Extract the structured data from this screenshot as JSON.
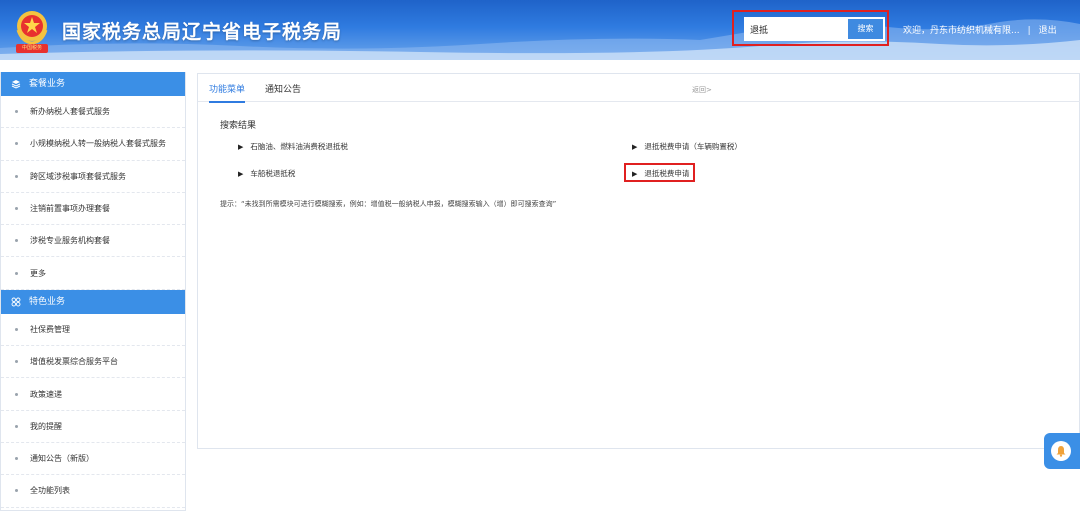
{
  "header": {
    "site_title": "国家税务总局辽宁省电子税务局",
    "logo_band_text": "中国税务",
    "search_value": "退抵",
    "search_button": "搜索",
    "welcome_text": "欢迎，丹东市纺织机械有限...",
    "logout": "退出",
    "separator": "|"
  },
  "sidebar": {
    "sections": [
      {
        "title": "套餐业务",
        "icon": "layers-icon",
        "items": [
          "新办纳税人套餐式服务",
          "小规模纳税人转一般纳税人套餐式服务",
          "跨区域涉税事项套餐式服务",
          "注销前置事项办理套餐",
          "涉税专业服务机构套餐",
          "更多"
        ]
      },
      {
        "title": "特色业务",
        "icon": "grid-icon",
        "items": [
          "社保费管理",
          "增值税发票综合服务平台",
          "政策速递",
          "我的提醒",
          "通知公告（新版）",
          "全功能列表"
        ]
      }
    ]
  },
  "main": {
    "tabs": [
      "功能菜单",
      "通知公告"
    ],
    "back_link": "返回>",
    "results_title": "搜索结果",
    "results": [
      "石脑油、燃料油消费税退抵税",
      "退抵税费申请（车辆购置税）",
      "车船税退抵税",
      "退抵税费申请"
    ],
    "hint": "提示：“未找到所需模块可进行模糊搜索，例如：增值税一般纳税人申报，模糊搜索输入（增）即可搜索查询”"
  },
  "colors": {
    "accent": "#3b8fe6",
    "highlight_box": "#e02020",
    "header_blue": "#1f63c9"
  },
  "float_widget": {
    "icon": "bell-icon"
  }
}
